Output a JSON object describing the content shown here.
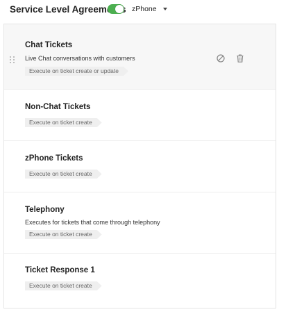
{
  "header": {
    "title": "Service Level Agreements",
    "toggle_on": true,
    "department": "zPhone"
  },
  "sla_items": [
    {
      "title": "Chat Tickets",
      "description": "Live Chat conversations with customers",
      "tag": "Execute on ticket create or update",
      "active": true,
      "icons": [
        "disable-icon",
        "trash-icon"
      ]
    },
    {
      "title": "Non-Chat Tickets",
      "description": "",
      "tag": "Execute on ticket create"
    },
    {
      "title": "zPhone Tickets",
      "description": "",
      "tag": "Execute on ticket create"
    },
    {
      "title": "Telephony",
      "description": "Executes for tickets that come through telephony",
      "tag": "Execute on ticket create"
    },
    {
      "title": "Ticket Response 1",
      "description": "",
      "tag": "Execute on ticket create"
    }
  ],
  "colors": {
    "toggle_on": "#4caf50",
    "active_card_bg": "#f7f7f7",
    "tag_bg": "#efefef"
  }
}
